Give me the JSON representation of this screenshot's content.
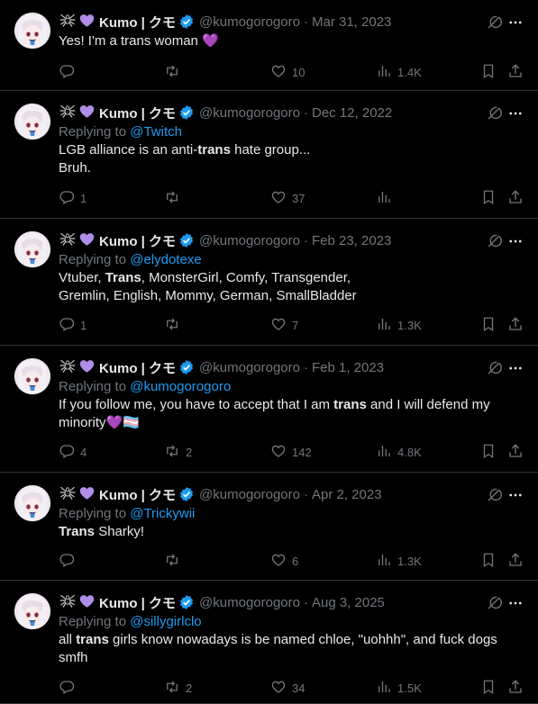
{
  "colors": {
    "background": "#000000",
    "text": "#e7e9ea",
    "muted": "#71767b",
    "link": "#1d9bf0",
    "divider": "#2f3336",
    "verified": "#1d9bf0"
  },
  "icons": {
    "name_icons": [
      "spider-icon",
      "purple-heart-icon"
    ],
    "verified": "verified-badge-icon",
    "grok": "grok-icon",
    "more": "more-icon",
    "reply": "reply-icon",
    "retweet": "retweet-icon",
    "like": "like-icon",
    "views": "views-icon",
    "bookmark": "bookmark-icon",
    "share": "share-icon"
  },
  "tweets": [
    {
      "name": "Kumo | クモ",
      "handle": "@kumogorogoro",
      "separator": "·",
      "date": "Mar 31, 2023",
      "reply_prefix": "",
      "reply_to": "",
      "lines": [
        {
          "parts": [
            "Yes! I'm a trans woman 💜"
          ]
        }
      ],
      "stats": {
        "replies": "",
        "retweets": "",
        "likes": "10",
        "views": "1.4K"
      }
    },
    {
      "name": "Kumo | クモ",
      "handle": "@kumogorogoro",
      "separator": "·",
      "date": "Dec 12, 2022",
      "reply_prefix": "Replying to",
      "reply_to": "@Twitch",
      "lines": [
        {
          "parts": [
            "LGB alliance is an anti-",
            "trans",
            " hate group..."
          ]
        },
        {
          "parts": [
            "Bruh."
          ]
        }
      ],
      "stats": {
        "replies": "1",
        "retweets": "",
        "likes": "37",
        "views": ""
      }
    },
    {
      "name": "Kumo | クモ",
      "handle": "@kumogorogoro",
      "separator": "·",
      "date": "Feb 23, 2023",
      "reply_prefix": "Replying to",
      "reply_to": "@elydotexe",
      "lines": [
        {
          "parts": [
            "Vtuber, ",
            "Trans",
            ", MonsterGirl, Comfy, Transgender,"
          ]
        },
        {
          "parts": [
            "Gremlin, English, Mommy, German, SmallBladder"
          ]
        }
      ],
      "stats": {
        "replies": "1",
        "retweets": "",
        "likes": "7",
        "views": "1.3K"
      }
    },
    {
      "name": "Kumo | クモ",
      "handle": "@kumogorogoro",
      "separator": "·",
      "date": "Feb 1, 2023",
      "reply_prefix": "Replying to",
      "reply_to": "@kumogorogoro",
      "lines": [
        {
          "parts": [
            "If you follow me, you have to accept that I am ",
            "trans",
            " and I will defend my"
          ]
        },
        {
          "parts": [
            "minority💜🏳️‍⚧️"
          ]
        }
      ],
      "stats": {
        "replies": "4",
        "retweets": "2",
        "likes": "142",
        "views": "4.8K"
      }
    },
    {
      "name": "Kumo | クモ",
      "handle": "@kumogorogoro",
      "separator": "·",
      "date": "Apr 2, 2023",
      "reply_prefix": "Replying to",
      "reply_to": "@Trickywii",
      "lines": [
        {
          "parts": [
            "",
            "Trans",
            " Sharky!"
          ]
        }
      ],
      "stats": {
        "replies": "",
        "retweets": "",
        "likes": "6",
        "views": "1.3K"
      }
    },
    {
      "name": "Kumo | クモ",
      "handle": "@kumogorogoro",
      "separator": "·",
      "date": "Aug 3, 2025",
      "reply_prefix": "Replying to",
      "reply_to": "@sillygirlclo",
      "lines": [
        {
          "parts": [
            "all ",
            "trans",
            " girls know nowadays is be named chloe, \"uohhh\", and fuck dogs"
          ]
        },
        {
          "parts": [
            "smfh"
          ]
        }
      ],
      "stats": {
        "replies": "",
        "retweets": "2",
        "likes": "34",
        "views": "1.5K"
      }
    }
  ]
}
